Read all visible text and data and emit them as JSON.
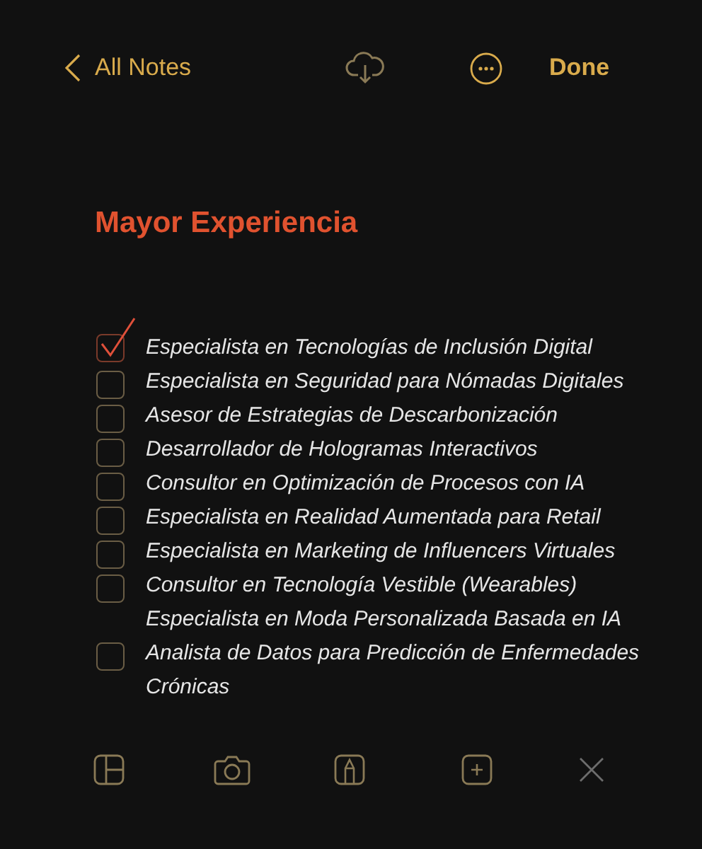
{
  "nav_bar": {
    "back_label": "All Notes",
    "done_label": "Done"
  },
  "note": {
    "title": "Mayor Experiencia",
    "checklist": [
      {
        "kind": "checkbox",
        "checked": true,
        "text": "Especialista en Tecnologías de Inclusión Digital"
      },
      {
        "kind": "checkbox",
        "checked": false,
        "text": "Especialista en Seguridad para Nómadas Digitales"
      },
      {
        "kind": "checkbox",
        "checked": false,
        "text": "Asesor de Estrategias de Descarbonización"
      },
      {
        "kind": "checkbox",
        "checked": false,
        "text": "Desarrollador de Hologramas Interactivos"
      },
      {
        "kind": "checkbox",
        "checked": false,
        "text": "Consultor en Optimización de Procesos con IA"
      },
      {
        "kind": "checkbox",
        "checked": false,
        "text": "Especialista en Realidad Aumentada para Retail"
      },
      {
        "kind": "checkbox",
        "checked": false,
        "text": "Especialista en Marketing de Influencers Virtuales"
      },
      {
        "kind": "checkbox",
        "checked": false,
        "text": "Consultor en Tecnología Vestible (Wearables)"
      },
      {
        "kind": "text",
        "text": "Especialista en Moda Personalizada Basada en IA"
      },
      {
        "kind": "checkbox",
        "checked": false,
        "text": "Analista de Datos para Predicción de Enfermedades Crónicas"
      }
    ]
  }
}
